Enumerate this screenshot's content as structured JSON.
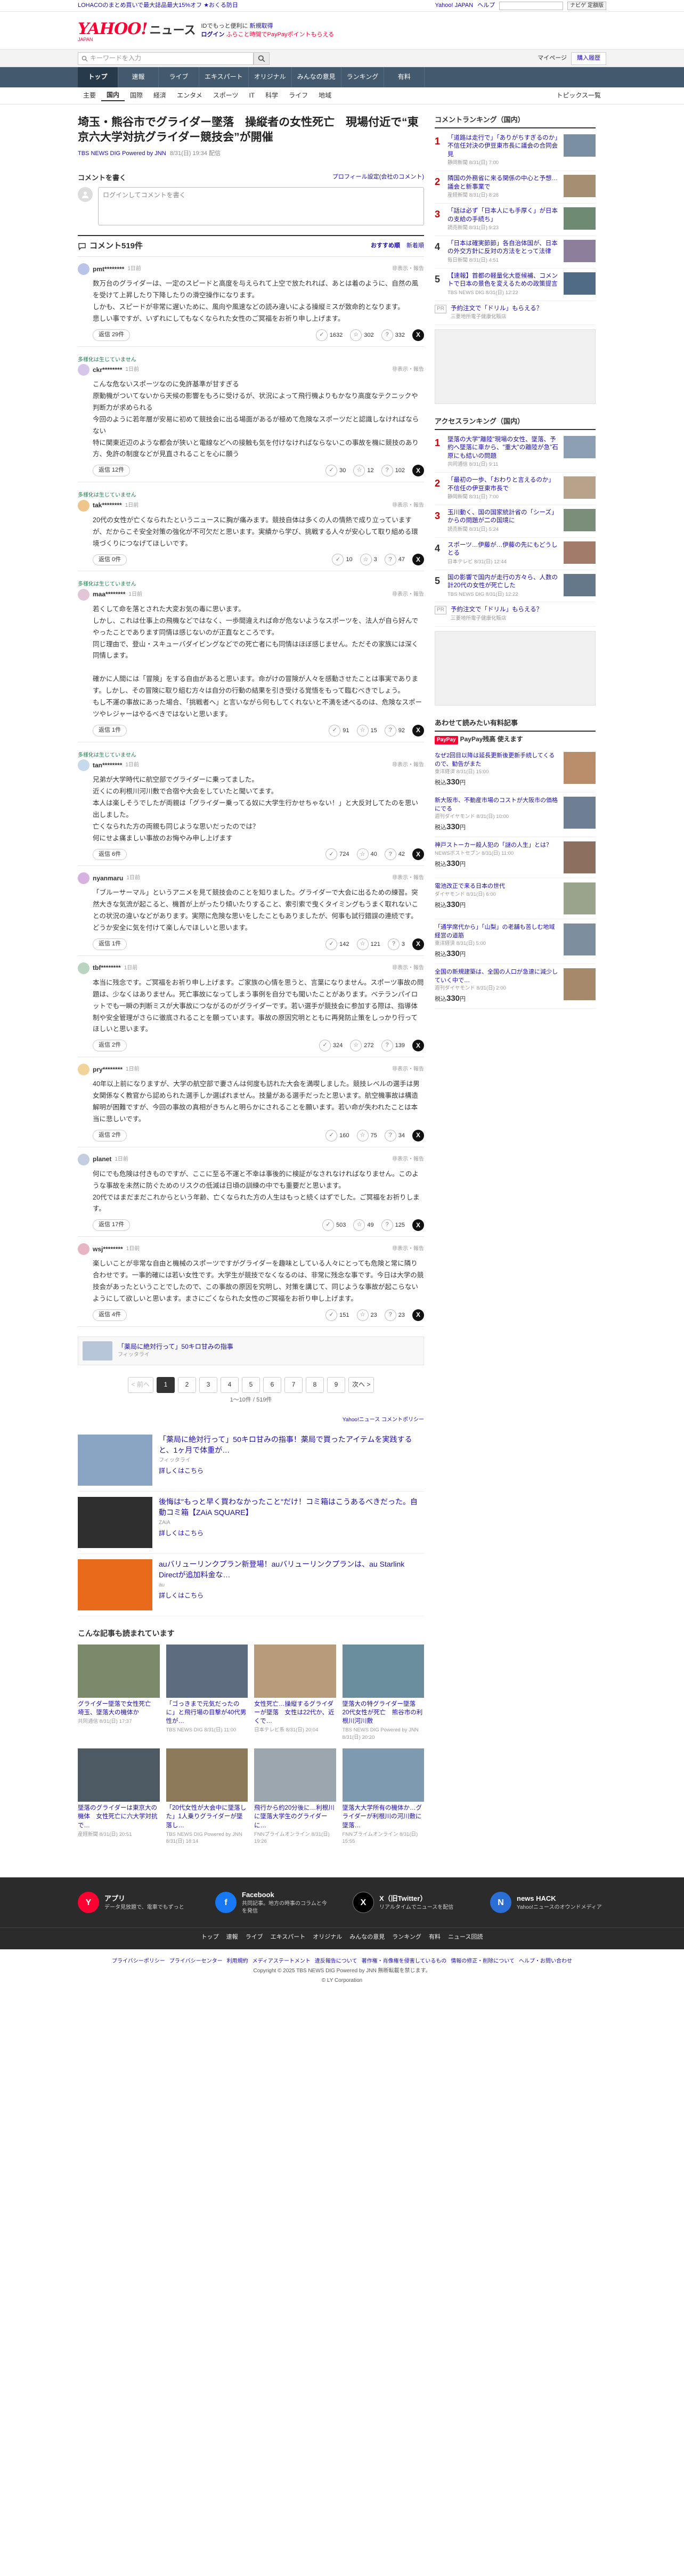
{
  "promo": {
    "text": "LOHACOのまとめ買いで最大誌品最大15%オフ ★おくる防日",
    "links": [
      "Yahoo! JAPAN",
      "ヘルプ"
    ],
    "mini_search_btn": "ナビゲ 定額版"
  },
  "header": {
    "logo_main": "YAHOO!",
    "logo_sub": "JAPAN",
    "logo_news": "ニュース",
    "row1": "IDでもっと便利に",
    "row1_link": "新規取得",
    "row2_login": "ログイン",
    "row2_paypay": "ふらこと時間でPayPayポイントもらえる"
  },
  "search": {
    "placeholder": "キーワードを入力",
    "links": [
      "マイページ",
      "購入履歴"
    ]
  },
  "nav": {
    "tabs": [
      "トップ",
      "速報",
      "ライブ",
      "エキスパート",
      "オリジナル",
      "みんなの意見",
      "ランキング",
      "有料"
    ],
    "subs": [
      "主要",
      "国内",
      "国際",
      "経済",
      "エンタメ",
      "スポーツ",
      "IT",
      "科学",
      "ライフ",
      "地域"
    ],
    "more": "トピックス一覧"
  },
  "article": {
    "title": "埼玉・熊谷市でグライダー墜落　操縦者の女性死亡　現場付近で“東京六大学対抗グライダー競技会”が開催",
    "source": "TBS NEWS DIG Powered by JNN",
    "time": "8/31(日) 19:34 配信"
  },
  "compose": {
    "heading": "コメントを書く",
    "policy": "プロフィール設定(会社のコメント)",
    "placeholder": "ログインしてコメントを書く"
  },
  "comments_bar": {
    "count": "コメント519件",
    "sort_recommend": "おすすめ順",
    "sort_new": "新着順"
  },
  "comments": [
    {
      "user": "pmt********",
      "time": "1日前",
      "report": "非表示・報告",
      "av": "#b9c4e8",
      "body": "数万台のグライダーは、一定のスピードと高度を与えられて上空で放たれれば、あとは着のように、自然の風を受けて上昇したり下降したりの滑空操作になります。\nしかも、スピードが非常に遅いために、風向や風速などの読み違いによる操縦ミスが致命的となります。\n悲しい事ですが、いずれにしてもなくなられた女性のご冥福をお祈り申し上げます。",
      "reply": "返信 29件",
      "r1": "1632",
      "r2": "302",
      "r3": "332",
      "expert": ""
    },
    {
      "user": "ckr********",
      "time": "1日前",
      "report": "非表示・報告",
      "av": "#d6c7ea",
      "body": "こんな危ないスポーツなのに免許基準が甘すぎる\n原動機がついてないから天候の影響をもろに受けるが、状況によって飛行機よりもかなり高度なテクニックや判断力が求められる\n今回のように若年層が安易に初めて競技会に出る場面があるが極めて危険なスポーツだと認識しなければならない\n特に関東近辺のような都会が狭いと電線などへの接触も気を付けなければならないこの事故を機に競技のあり方、免許の制度などが見直されることを心に願う",
      "reply": "返信 12件",
      "r1": "30",
      "r2": "12",
      "r3": "102",
      "expert": "多様化は生じていません"
    },
    {
      "user": "tak********",
      "time": "1日前",
      "report": "非表示・報告",
      "av": "#f0c58b",
      "body": "20代の女性が亡くなられたというニュースに胸が痛みます。競技自体は多くの人の情熱で成り立っていますが、だからこそ安全対策の強化が不可欠だと思います。実績から学び、挑戦する人々が安心して取り組める環境づくりにつなげてほしいです。",
      "reply": "返信 0件",
      "r1": "10",
      "r2": "3",
      "r3": "47",
      "expert": "多様化は生じていません"
    },
    {
      "user": "maa********",
      "time": "1日前",
      "report": "非表示・報告",
      "av": "#e3c5d8",
      "body": "若くして命を落とされた大変お気の毒に思います。\nしかし、これは仕事上の飛機などではなく、一歩間違えれば命が危ないようなスポーツを、法人が自ら好んでやったことであります同情は感じないのが正直なところです。\n同じ理由で、登山・スキューバダイビングなどでの死亡者にも同情はほぼ感じません。ただその家族には深く同情します。\n\n確かに人間には「冒険」をする自由があると思います。命がけの冒険が人々を感動させたことは事実であります。しかし、その冒険に取り組む方々は自分の行動の結果を引き受ける覚悟をもって臨むべきでしょう。\nもし不運の事故にあった場合、「挑戦者へ」と言いながら何もしてくれないと不満を述べるのは、危険なスポーツやレジャーはやるべきではないと思います。",
      "reply": "返信 1件",
      "r1": "91",
      "r2": "15",
      "r3": "92",
      "expert": "多様化は生じていません"
    },
    {
      "user": "tan********",
      "time": "1日前",
      "report": "非表示・報告",
      "av": "#c7d9ec",
      "body": "兄弟が大学時代に航空部でグライダーに乗ってました。\n近くにの利根川河川敷で合宿や大会をしていたと聞いてます。\n本人は楽しそうでしたが両親は「グライダー乗ってる奴に大学生行かせちゃない！」と大反対してたのを思い出しました。\n亡くなられた方の両親も同じような思いだったのでは？\n何にせよ痛ましい事故のお悔やみ申し上げます",
      "reply": "返信 6件",
      "r1": "724",
      "r2": "40",
      "r3": "42",
      "expert": "多様化は生じていません"
    },
    {
      "user": "nyanmaru",
      "time": "1日前",
      "report": "非表示・報告",
      "av": "#d5b2e0",
      "body": "「ブルーサーマル」というアニメを見て競技会のことを知りました。グライダーで大会に出るための練習。突然大きな気流が起こると、機首が上がったり傾いたりすること、索引索で曳くタイミングもうまく取れないことの状況の違いなどがあります。実際に危険な思いをしたこともありましたが、何事も試行錯誤の連続です。どうか安全に気を付けて楽しんでほしいと思います。",
      "reply": "返信 1件",
      "r1": "142",
      "r2": "121",
      "r3": "3",
      "expert": ""
    },
    {
      "user": "tbf********",
      "time": "1日前",
      "report": "非表示・報告",
      "av": "#b9d4c1",
      "body": "本当に残念です。ご冥福をお祈り申し上げます。ご家族の心情を思うと、言葉になりません。スポーツ事故の問題は、少なくはありません。死亡事故になってしまう事例を自分でも聞いたことがあります。ベテランパイロットでも一瞬の判断ミスが大事故につながるのがグライダーです。若い選手が競技会に参加する際は、指導体制や安全管理がさらに徹底されることを願っています。事故の原因究明とともに再発防止策をしっかり行ってほしいと思います。",
      "reply": "返信 2件",
      "r1": "324",
      "r2": "272",
      "r3": "139",
      "expert": ""
    },
    {
      "user": "pry********",
      "time": "1日前",
      "report": "非表示・報告",
      "av": "#f2d49b",
      "body": "40年以上前になりますが、大学の航空部で妻さんは何度も訪れた大会を満喫しました。競技レベルの選手は男女関係なく教官から認められた選手しか選ばれません。技量がある選手だったと思います。航空機事故は構造解明が困難ですが、今回の事故の真相がきちんと明らかにされることを願います。若い命が失われたことは本当に悲しいです。",
      "reply": "返信 2件",
      "r1": "160",
      "r2": "75",
      "r3": "34",
      "expert": ""
    },
    {
      "user": "planet",
      "time": "1日前",
      "report": "非表示・報告",
      "av": "#c2cde0",
      "body": "何にでも危険は付きものですが、ここに至る不運と不幸は事後的に検証がなされなければなりません。このような事故を未然に防ぐためのリスクの低減は日頃の訓練の中でも重要だと思います。\n20代ではまだまだこれからという年齢、亡くなられた方の人生はもっと続くはずでした。ご冥福をお祈りします。",
      "reply": "返信 17件",
      "r1": "503",
      "r2": "49",
      "r3": "125",
      "expert": ""
    },
    {
      "user": "wsj********",
      "time": "1日前",
      "report": "非表示・報告",
      "av": "#e6b6c4",
      "body": "楽しいことが非常な自由と機械のスポーツですがグライダーを趣味としている人々にとっても危険と常に隣り合わせです。一事的確には若い女性です。大学生が競技でなくなるのは、非常に残念な事です。今日は大学の競技会があったということでしたので、この事故の原因を究明し、対策を講じて、同じような事故が起こらないようにして欲しいと思います。まさにごくなられた女性のご冥福をお祈り申し上げます。",
      "reply": "返信 4件",
      "r1": "151",
      "r2": "23",
      "r3": "23",
      "expert": ""
    }
  ],
  "ad_banner": {
    "title": "「薬局に絶対行って」50キロ甘みの指事",
    "sub": "フィッタライ"
  },
  "pager": {
    "prev": "< 前へ",
    "pages": [
      "1",
      "2",
      "3",
      "4",
      "5",
      "6",
      "7",
      "8",
      "9"
    ],
    "next": "次へ >",
    "info": "1〜10件 / 519件"
  },
  "policy_link": "Yahoo!ニュース コメントポリシー",
  "ads": [
    {
      "title": "「薬局に絶対行って」50キロ甘みの指事！薬局で買ったアイテムを実践すると、1ヶ月で体重が…",
      "sub": "フィッタライ",
      "cta": "詳しくはこちら",
      "color": "#8aa4c4"
    },
    {
      "title": "後悔は\"もっと早く買わなかったこと\"だけ！コミ箱はこうあるべきだった。自動コミ箱【ZAiA SQUARE】",
      "sub": "ZAiA",
      "cta": "詳しくはこちら",
      "color": "#2f2f2f"
    },
    {
      "title": "auバリューリンクプラン新登場！auバリューリンクプランは、au Starlink Directが追加料金な…",
      "sub": "au",
      "cta": "詳しくはこちら",
      "color": "#e96a1a"
    }
  ],
  "also": {
    "heading": "こんな記事も読まれています",
    "items": [
      {
        "title": "グライダー墜落で女性死亡　埼玉、墜落大の機体か",
        "meta": "共同通信 8/31(日) 17:37",
        "color": "#7a8a6a"
      },
      {
        "title": "「ゴっきまで元気だったのに」と飛行場の目撃が40代男性が…",
        "meta": "TBS NEWS DIG 8/31(日) 11:00",
        "color": "#5c6b7d"
      },
      {
        "title": "女性死亡…操縦するグライダーが墜落　女性は22代か、近くで…",
        "meta": "日本テレビ系 8/31(日) 20:04",
        "color": "#b89b7a"
      },
      {
        "title": "墜落大の特グライダー墜落 20代女性が死亡　熊谷市の利根川河川敷",
        "meta": "TBS NEWS DIG Powered by JNN 8/31(日) 20:20",
        "color": "#6a8d9e"
      },
      {
        "title": "墜落のグライダーは東京大の機体　女性死亡に六大学対抗で…",
        "meta": "産経新聞 8/31(日) 20:51",
        "color": "#4d5a64"
      },
      {
        "title": "「20代女性が大会中に墜落した」1人乗りグライダーが墜落し…",
        "meta": "TBS NEWS DIG Powered by JNN 8/31(日) 18:14",
        "color": "#8d7a5a"
      },
      {
        "title": "飛行から約20分後に…利根川に墜落大学生のグライダーに…",
        "meta": "FNNプライムオンライン 8/31(日) 19:26",
        "color": "#9ba6ae"
      },
      {
        "title": "墜落大大学所有の機体か…グライダーが利根川の河川敷に墜落…",
        "meta": "FNNプライムオンライン 8/31(日) 15:55",
        "color": "#7e9ab0"
      }
    ]
  },
  "side": {
    "ranking_title": "コメントランキング（国内）",
    "ranking": [
      {
        "n": "1",
        "t": "「道路は走行で」「ありがちすぎるのか」不信任対決の伊豆東市長に議会の合同会見",
        "s": "静岡新聞 8/31(日) 7:00",
        "c": "#7b8fa3"
      },
      {
        "n": "2",
        "t": "隣国の外務省に来る関係の中心と予想…議会と新事業で",
        "s": "産経新聞 8/31(日) 8:28",
        "c": "#a68e72"
      },
      {
        "n": "3",
        "t": "「話は必ず「日本人にも手厚く」が日本の支給の手続ち」",
        "s": "読売新聞 8/31(日) 9:23",
        "c": "#6e8a73"
      },
      {
        "n": "4",
        "t": "「日本は確実節節」各自治体国が、日本の外交方針に反対の方法をとって法律",
        "s": "毎日新聞 8/31(日) 4:51",
        "c": "#8d7e9c"
      },
      {
        "n": "5",
        "t": "【速報】首都の軽量化大臣候補、コメントで日本の景色を変えるための政策提言",
        "s": "TBS NEWS DIG 8/31(日) 12:22",
        "c": "#4f6b86"
      },
      {
        "n": "PR",
        "t": "予約注文で「ドリル」もらえる？",
        "s": "三菱地所電子健康化販店",
        "c": ""
      }
    ],
    "access_title": "アクセスランキング（国内）",
    "access": [
      {
        "n": "1",
        "t": "墜落の大学\"離陸\"現場の女性、墜落、予約へ墜落に車から、\"重大\"の離陸が急\"石原にも結いの問題",
        "s": "共同通信 8/31(日) 9:11",
        "c": "#8d9fb2"
      },
      {
        "n": "2",
        "t": "「最初の一歩、「おわりと言えるのか」不信任の伊豆東市長で",
        "s": "静岡新聞 8/31(日) 7:00",
        "c": "#b9a28a"
      },
      {
        "n": "3",
        "t": "玉川動く、国の国家統計省の「シーズ」からの問題が二の国境に",
        "s": "読売新聞 8/31(日) 5:24",
        "c": "#7a8e7a"
      },
      {
        "n": "4",
        "t": "スポーツ…伊藤が…伊藤の先にもどうしとる",
        "s": "日本テレビ 8/31(日) 12:44",
        "c": "#a37b6b"
      },
      {
        "n": "5",
        "t": "国の影響で国内が走行の方々ら、人数の計20代の女性が死亡した",
        "s": "TBS NEWS DIG 8/31(日) 12:22",
        "c": "#65788a"
      },
      {
        "n": "PR",
        "t": "予約注文で「ドリル」もらえる？",
        "s": "三菱地所電子健康化販店",
        "c": ""
      }
    ],
    "paypay_title": "あわせて読みたい有料記事",
    "paypay_logo": "PayPay",
    "paypay_label": "PayPay残高 使えます",
    "paypay": [
      {
        "t": "なぜ2回目以降は延長更新後更新手続してくるので、勧告がまた",
        "s": "東洋経済 8/31(日) 15:00",
        "p": "330",
        "c": "#b98c6a"
      },
      {
        "t": "新大阪市、不動産市場のコストが大阪市の価格にでる",
        "s": "週刊ダイヤモンド 8/31(日) 10:00",
        "p": "330",
        "c": "#6e7f93"
      },
      {
        "t": "神戸ストーカー殺人犯の「謎の人生」とは？",
        "s": "NEWSポストセブン 8/31(日) 11:00",
        "p": "330",
        "c": "#8c6f5f"
      },
      {
        "t": "電池改正で来る日本の世代",
        "s": "ダイヤモンド 8/31(日) 6:00",
        "p": "330",
        "c": "#9aa48c"
      },
      {
        "t": "「通学席代から」「山梨」の老舗も苦しむ地域経営の道筋",
        "s": "東洋経済 8/31(日) 5:00",
        "p": "330",
        "c": "#7d8e9e"
      },
      {
        "t": "全国の新規建築は、全国の人口が急速に減少していく中で…",
        "s": "週刊ダイヤモンド 8/31(日) 2:00",
        "p": "330",
        "c": "#a6896b"
      }
    ]
  },
  "footer": {
    "apps": [
      {
        "name": "アプリ",
        "desc": "データ見放題で、電車でもずっと",
        "icon": "Y",
        "color": "#ff0033"
      },
      {
        "name": "Facebook",
        "desc": "共同記事。地方の時事のコラムと今を発信",
        "icon": "f",
        "color": "#1877f2"
      },
      {
        "name": "X（旧Twitter）",
        "desc": "リアルタイムでニュースを配信",
        "icon": "X",
        "color": "#000000"
      },
      {
        "name": "news HACK",
        "desc": "Yahoo!ニュースのオウンドメディア",
        "icon": "N",
        "color": "#2b6fd6"
      }
    ],
    "links": [
      "トップ",
      "速報",
      "ライブ",
      "エキスパート",
      "オリジナル",
      "みんなの意見",
      "ランキング",
      "有料",
      "ニュース回読"
    ],
    "bottom_links": [
      "プライバシーポリシー",
      "プライバシーセンター",
      "利用規約",
      "メディアステートメント",
      "違反報告について",
      "著作権・肖像権を侵害しているもの",
      "情報の修正・削除について",
      "ヘルプ・お問い合わせ"
    ],
    "copyright1": "Copyright © 2025 TBS NEWS DIG Powered by JNN 無断転載を禁じます。",
    "copyright2": "© LY Corporation"
  }
}
